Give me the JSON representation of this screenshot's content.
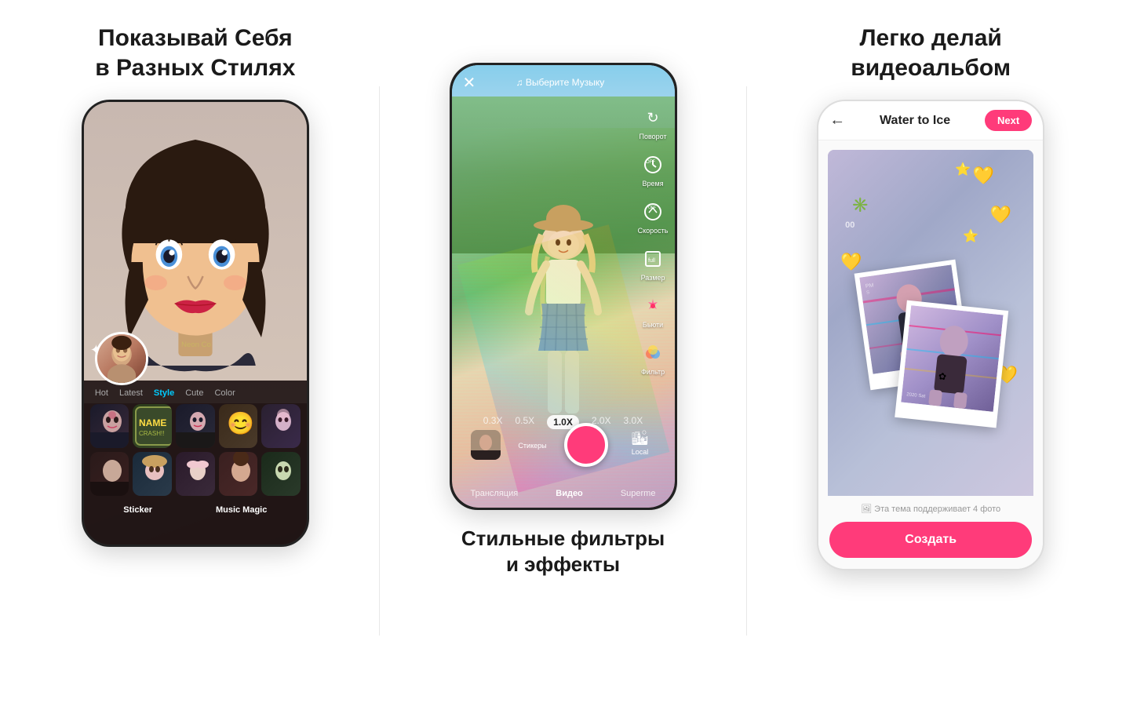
{
  "panel1": {
    "title": "Показывай Себя\nв Разных Стилях",
    "filter_tabs": [
      {
        "label": "Hot",
        "active": false
      },
      {
        "label": "Latest",
        "active": false
      },
      {
        "label": "Style",
        "active": true
      },
      {
        "label": "Cute",
        "active": false
      },
      {
        "label": "Color",
        "active": false
      }
    ],
    "bottom_labels": [
      {
        "label": "Sticker"
      },
      {
        "label": "Music Magic"
      }
    ]
  },
  "panel2": {
    "title": "Стильные фильтры\nи эффекты",
    "music_label": "♫ Выберите Музыку",
    "controls": [
      {
        "icon": "↻",
        "label": "Поворот"
      },
      {
        "icon": "⏱",
        "label": "Время"
      },
      {
        "icon": "⚡",
        "label": "Скорость"
      },
      {
        "icon": "⊞",
        "label": "Размер"
      },
      {
        "icon": "♠",
        "label": "Бьюти"
      },
      {
        "icon": "◉",
        "label": "Фильтр"
      }
    ],
    "zoom_options": [
      {
        "value": "0.3X",
        "active": false
      },
      {
        "value": "0.5X",
        "active": false
      },
      {
        "value": "1.0X",
        "active": true
      },
      {
        "value": "2.0X",
        "active": false
      },
      {
        "value": "3.0X",
        "active": false
      }
    ],
    "nav_items": [
      {
        "label": "Трансляция",
        "active": false
      },
      {
        "label": "Видео",
        "active": true
      },
      {
        "label": "Superme",
        "active": false
      }
    ],
    "stickers_label": "Стикеры",
    "local_label": "Local"
  },
  "panel3": {
    "title": "Легко делай\nвидеоальбом",
    "header": {
      "back": "←",
      "title": "Water to Ice",
      "next_label": "Next"
    },
    "supports_label": "🖼 Эта тема поддерживает 4 фото",
    "create_label": "Создать",
    "emojis": [
      "💛",
      "⭐",
      "💛",
      "✳️",
      "⭐",
      "💛",
      "⭐"
    ]
  }
}
